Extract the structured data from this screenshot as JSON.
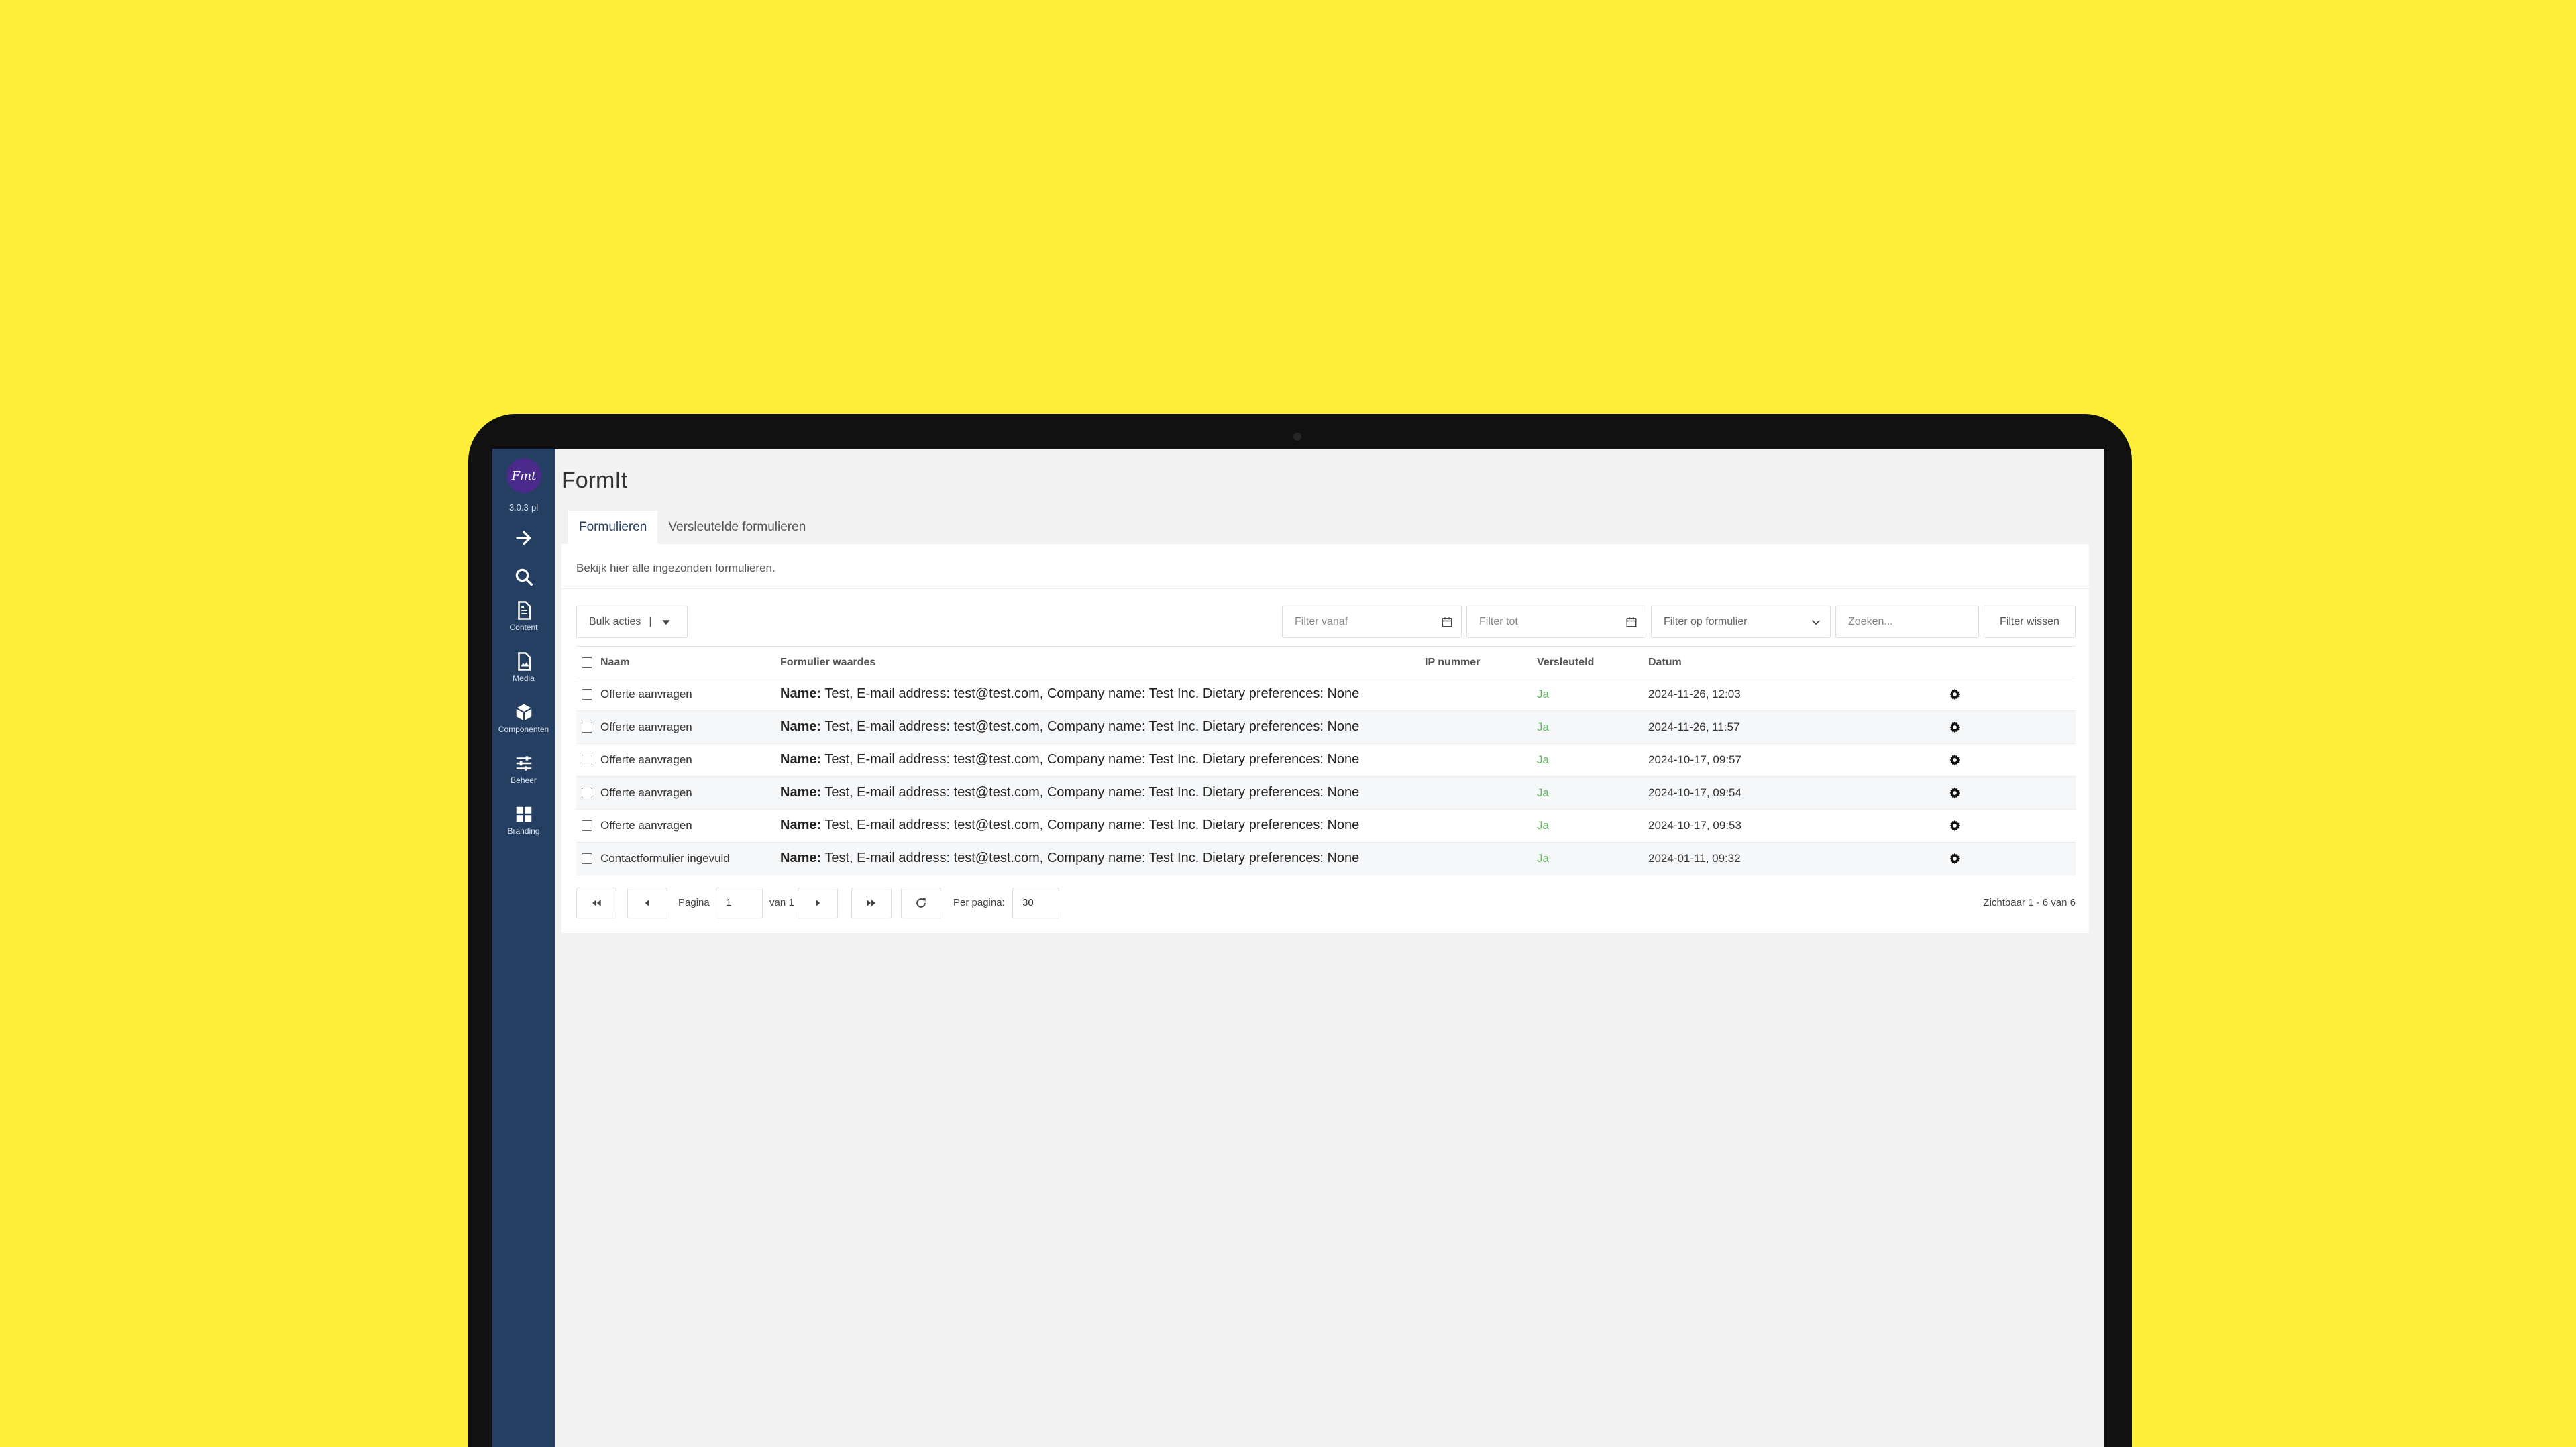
{
  "app": {
    "title": "FormIt",
    "version": "3.0.3-pl",
    "logo_text": "Fmt"
  },
  "sidebar": {
    "items": [
      {
        "label": "",
        "icon": "arrow-right-icon"
      },
      {
        "label": "",
        "icon": "search-icon"
      },
      {
        "label": "Content",
        "icon": "document-icon"
      },
      {
        "label": "Media",
        "icon": "image-file-icon"
      },
      {
        "label": "Componenten",
        "icon": "cube-icon"
      },
      {
        "label": "Beheer",
        "icon": "sliders-icon"
      },
      {
        "label": "Branding",
        "icon": "grid-icon"
      }
    ]
  },
  "tabs": [
    {
      "label": "Formulieren",
      "active": true
    },
    {
      "label": "Versleutelde formulieren",
      "active": false
    }
  ],
  "description": "Bekijk hier alle ingezonden formulieren.",
  "toolbar": {
    "bulk_label": "Bulk acties",
    "filter_from_placeholder": "Filter vanaf",
    "filter_to_placeholder": "Filter tot",
    "filter_form_placeholder": "Filter op formulier",
    "search_placeholder": "Zoeken...",
    "clear_label": "Filter wissen"
  },
  "table": {
    "headers": {
      "name": "Naam",
      "values": "Formulier waardes",
      "ip": "IP nummer",
      "encrypted": "Versleuteld",
      "date": "Datum"
    },
    "rows": [
      {
        "name": "Offerte aanvragen",
        "values_key": "Name:",
        "values_rest": " Test, E-mail address: test@test.com, Company name: Test Inc. Dietary preferences: None",
        "ip": "",
        "encrypted": "Ja",
        "date": "2024-11-26, 12:03"
      },
      {
        "name": "Offerte aanvragen",
        "values_key": "Name:",
        "values_rest": " Test, E-mail address: test@test.com, Company name: Test Inc. Dietary preferences: None",
        "ip": "",
        "encrypted": "Ja",
        "date": "2024-11-26, 11:57"
      },
      {
        "name": "Offerte aanvragen",
        "values_key": "Name:",
        "values_rest": " Test, E-mail address: test@test.com, Company name: Test Inc. Dietary preferences: None",
        "ip": "",
        "encrypted": "Ja",
        "date": "2024-10-17, 09:57"
      },
      {
        "name": "Offerte aanvragen",
        "values_key": "Name:",
        "values_rest": " Test, E-mail address: test@test.com, Company name: Test Inc. Dietary preferences: None",
        "ip": "",
        "encrypted": "Ja",
        "date": "2024-10-17, 09:54"
      },
      {
        "name": "Offerte aanvragen",
        "values_key": "Name:",
        "values_rest": " Test, E-mail address: test@test.com, Company name: Test Inc. Dietary preferences: None",
        "ip": "",
        "encrypted": "Ja",
        "date": "2024-10-17, 09:53"
      },
      {
        "name": "Contactformulier ingevuld",
        "values_key": "Name:",
        "values_rest": " Test, E-mail address: test@test.com, Company name: Test Inc. Dietary preferences: None",
        "ip": "",
        "encrypted": "Ja",
        "date": "2024-01-11, 09:32"
      }
    ]
  },
  "pagination": {
    "page_label": "Pagina",
    "page_value": "1",
    "of_label": "van 1",
    "per_page_label": "Per pagina:",
    "per_page_value": "30",
    "summary": "Zichtbaar 1 - 6 van 6"
  },
  "colors": {
    "background": "#ffef3b",
    "sidebar": "#253f63",
    "accent_green": "#5cb85c"
  }
}
